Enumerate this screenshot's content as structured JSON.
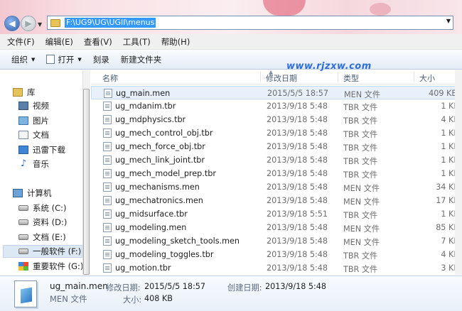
{
  "address": {
    "path": "F:\\UG9\\UG\\UGII\\menus"
  },
  "menu": [
    "文件(F)",
    "编辑(E)",
    "查看(V)",
    "工具(T)",
    "帮助(H)"
  ],
  "toolbar": {
    "organize": "组织",
    "open": "打开",
    "burn": "刻录",
    "new_folder": "新建文件夹"
  },
  "watermark": "www.rjzxw.com",
  "sidebar": {
    "items": [
      {
        "label": "库",
        "icon": "library-icon"
      },
      {
        "label": "视频",
        "icon": "video-icon"
      },
      {
        "label": "图片",
        "icon": "pictures-icon"
      },
      {
        "label": "文档",
        "icon": "documents-icon"
      },
      {
        "label": "迅雷下载",
        "icon": "download-icon"
      },
      {
        "label": "音乐",
        "icon": "music-icon"
      },
      {
        "label": "计算机",
        "icon": "computer-icon"
      },
      {
        "label": "系统 (C:)",
        "icon": "drive-icon"
      },
      {
        "label": "资料 (D:)",
        "icon": "drive-icon"
      },
      {
        "label": "文档 (E:)",
        "icon": "drive-icon"
      },
      {
        "label": "一般软件 (F:)",
        "icon": "drive-icon"
      },
      {
        "label": "重要软件 (G:)",
        "icon": "windows-drive-icon"
      }
    ]
  },
  "columns": {
    "name": "名称",
    "date": "修改日期",
    "type": "类型",
    "size": "大小"
  },
  "files": [
    {
      "name": "ug_main.men",
      "date": "2015/5/5 18:57",
      "type": "MEN 文件",
      "size": "409 KB"
    },
    {
      "name": "ug_mdanim.tbr",
      "date": "2013/9/18 5:48",
      "type": "TBR 文件",
      "size": "1 KB"
    },
    {
      "name": "ug_mdphysics.tbr",
      "date": "2013/9/18 5:48",
      "type": "TBR 文件",
      "size": "4 KB"
    },
    {
      "name": "ug_mech_control_obj.tbr",
      "date": "2013/9/18 5:48",
      "type": "TBR 文件",
      "size": "1 KB"
    },
    {
      "name": "ug_mech_force_obj.tbr",
      "date": "2013/9/18 5:48",
      "type": "TBR 文件",
      "size": "1 KB"
    },
    {
      "name": "ug_mech_link_joint.tbr",
      "date": "2013/9/18 5:48",
      "type": "TBR 文件",
      "size": "1 KB"
    },
    {
      "name": "ug_mech_model_prep.tbr",
      "date": "2013/9/18 5:48",
      "type": "TBR 文件",
      "size": "1 KB"
    },
    {
      "name": "ug_mechanisms.men",
      "date": "2013/9/18 5:48",
      "type": "MEN 文件",
      "size": "34 KB"
    },
    {
      "name": "ug_mechatronics.men",
      "date": "2013/9/18 5:48",
      "type": "MEN 文件",
      "size": "17 KB"
    },
    {
      "name": "ug_midsurface.tbr",
      "date": "2013/9/18 5:51",
      "type": "TBR 文件",
      "size": "1 KB"
    },
    {
      "name": "ug_modeling.men",
      "date": "2013/9/18 5:48",
      "type": "MEN 文件",
      "size": "85 KB"
    },
    {
      "name": "ug_modeling_sketch_tools.men",
      "date": "2013/9/18 5:48",
      "type": "MEN 文件",
      "size": "7 KB"
    },
    {
      "name": "ug_modeling_toggles.tbr",
      "date": "2013/9/18 5:48",
      "type": "TBR 文件",
      "size": "4 KB"
    },
    {
      "name": "ug_motion.tbr",
      "date": "2013/9/18 5:48",
      "type": "TBR 文件",
      "size": "3 KB"
    }
  ],
  "details": {
    "file_name": "ug_main.men",
    "file_type": "MEN 文件",
    "modified_label": "修改日期:",
    "modified_value": "2015/5/5 18:57",
    "created_label": "创建日期:",
    "created_value": "2013/9/18 5:48",
    "size_label": "大小:",
    "size_value": "408 KB"
  }
}
